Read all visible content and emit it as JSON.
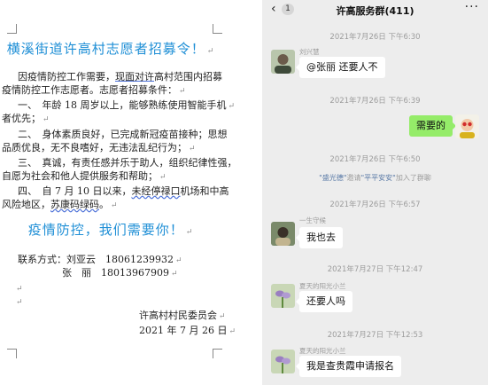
{
  "document": {
    "title": "横溪街道许高村志愿者招募令！",
    "para1_line1_prefix": "因疫情防控工作需要，",
    "para1_line1_ul": "现面对许",
    "para1_line1_suffix": "高村范围内招募",
    "para1_line2": "疫情防控工作志愿者。志愿者招募条件：",
    "item1_line1": "一、　年龄 18 周岁以上，能够熟练使用智能手机",
    "item1_line2": "者优先；",
    "item2_line1": "二、　身体素质良好，已完成新冠疫苗接种；思想",
    "item2_line2": "品质优良，无不良嗜好，无违法乱纪行为；",
    "item3_line1": "三、　真诚，有责任感并乐于助人，组织纪律性强，",
    "item3_line2": "自愿为社会和他人提供服务和帮助；",
    "item4_line1_prefix": "四、　自 7 月 10 日以来，",
    "item4_line1_ul": "未经停禄口",
    "item4_line1_suffix": "机场和中高",
    "item4_line2_prefix": "风险地区，",
    "item4_line2_ul": "苏康码绿码",
    "item4_line2_suffix": "。",
    "subtitle": "疫情防控，我们需要你！",
    "contact_label": "联系方式：刘亚云",
    "contact1_phone": "18061239932",
    "contact2_name": "张　丽",
    "contact2_phone": "18013967909",
    "org": "许高村村民委员会",
    "date": "2021 年 7 月 26 日"
  },
  "chat": {
    "back_icon": "chevron-left-icon",
    "unread_count": "1",
    "title": "许高服务群(411)",
    "more_icon": "more-dots-icon",
    "messages": [
      {
        "time": "2021年7月26日 下午6:30",
        "sender": "刘兴慧",
        "text": "@张丽 还要人不"
      },
      {
        "time": "2021年7月26日 下午6:39",
        "text": "需要的"
      },
      {
        "time": "2021年7月26日 下午6:50",
        "system_inviter": "\"盛光德\"",
        "system_mid": "邀请",
        "system_invitee": "\"平平安安\"",
        "system_suffix": "加入了群聊"
      },
      {
        "time": "2021年7月26日 下午6:57",
        "sender": "一生守候",
        "text": "我也去"
      },
      {
        "time": "2021年7月27日 下午12:47",
        "sender": "夏天的阳光小兰",
        "text": "还要人吗"
      },
      {
        "time": "2021年7月27日 下午12:53",
        "sender": "夏天的阳光小兰",
        "text": "我是查贵霞申请报名"
      }
    ]
  },
  "colors": {
    "accent_blue": "#1f8fd6",
    "bubble_green": "#95ec69",
    "chat_bg": "#ededed"
  }
}
